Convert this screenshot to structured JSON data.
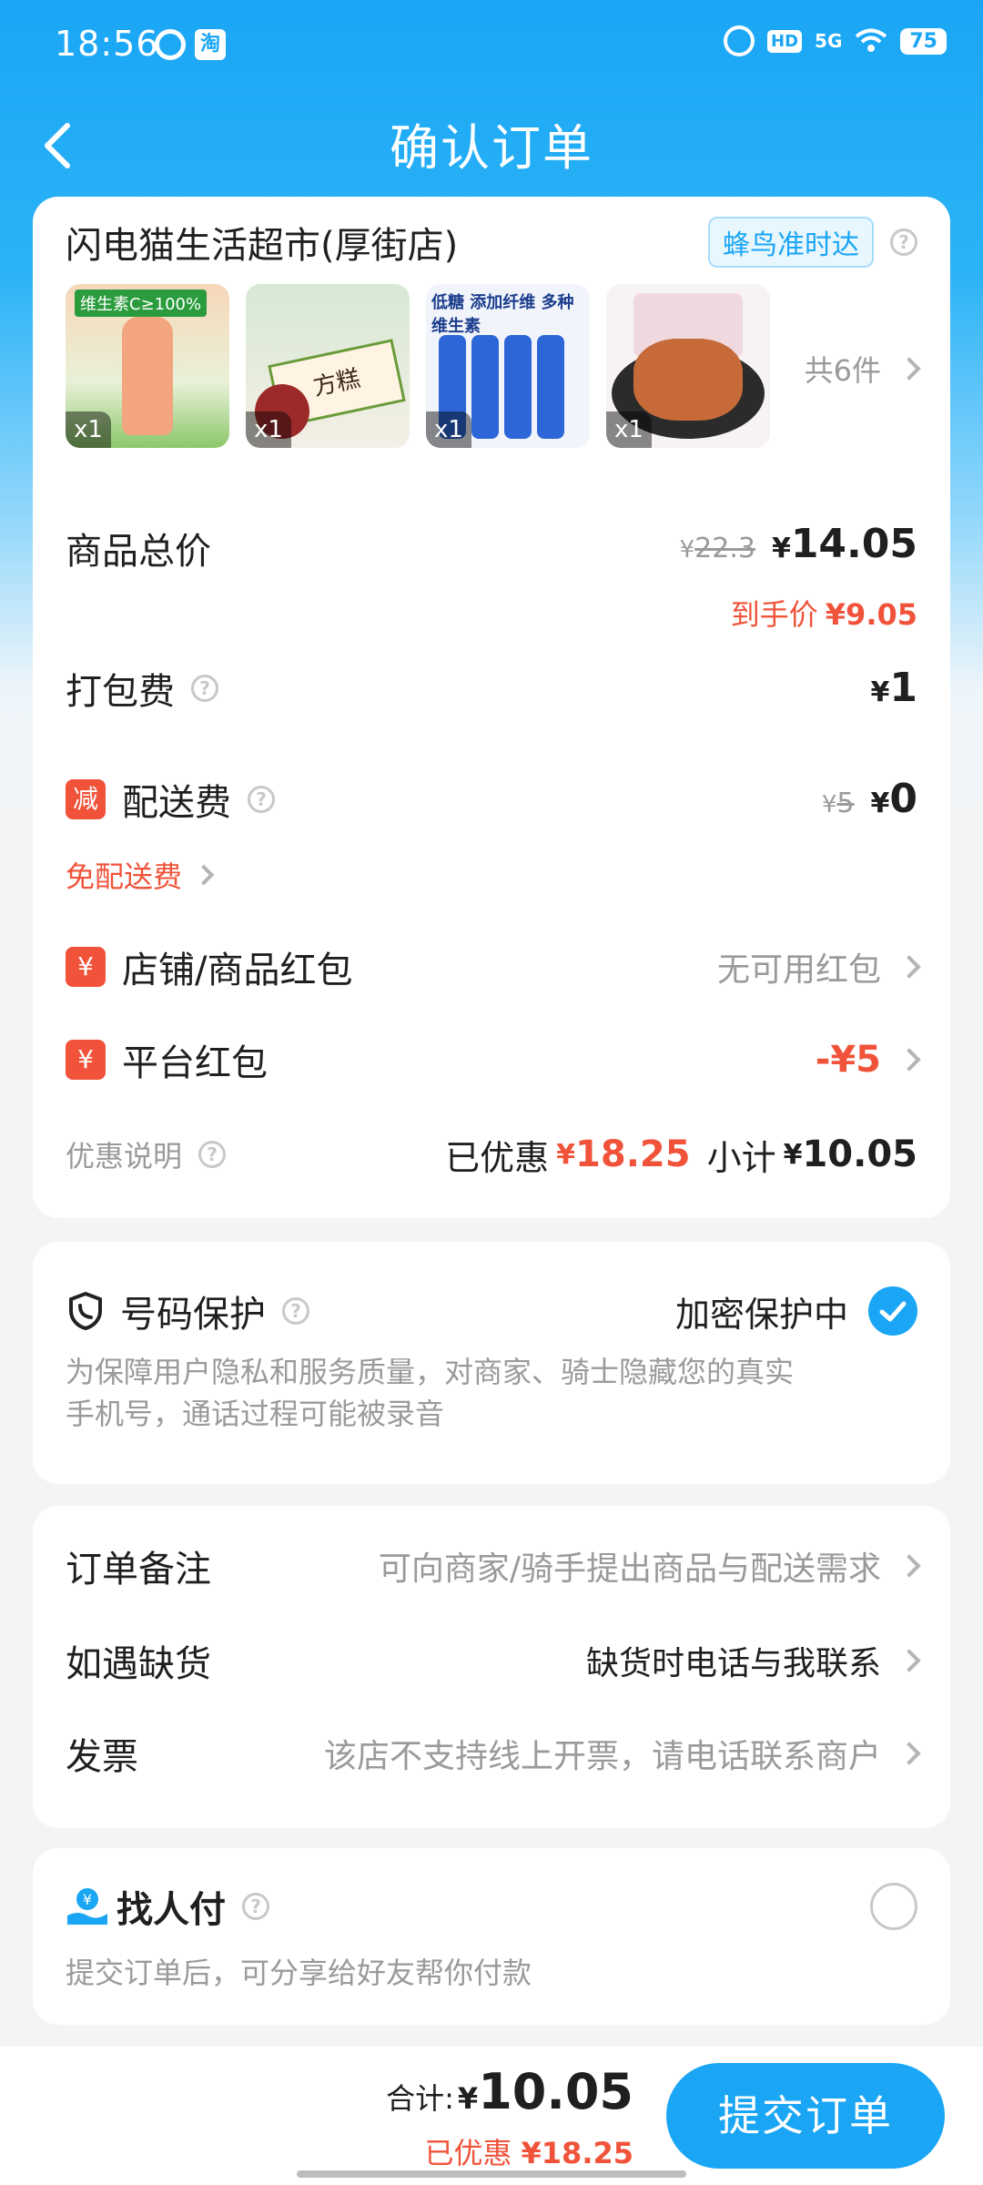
{
  "status_bar": {
    "time": "18:56",
    "battery": "75",
    "network": "5G"
  },
  "header": {
    "title": "确认订单"
  },
  "store": {
    "name": "闪电猫生活超市(厚街店)",
    "delivery_badge": "蜂鸟准时达",
    "items_count": "共6件",
    "items": [
      {
        "qty": "x1",
        "caption": "维生素C≥100%",
        "color": "#f3b58f"
      },
      {
        "qty": "x1",
        "caption": "方糕",
        "color": "#e8d2c0"
      },
      {
        "qty": "x1",
        "caption": "低糖 添加纤维 多种维生素",
        "color": "#2d66d6"
      },
      {
        "qty": "x1",
        "caption": "",
        "color": "#c66a3a"
      }
    ]
  },
  "summary": {
    "goods_total_label": "商品总价",
    "goods_original": "22.3",
    "goods_total": "14.05",
    "final_price_label": "到手价",
    "final_price": "¥9.05",
    "packing_fee_label": "打包费",
    "packing_fee": "1",
    "delivery_tag": "减",
    "delivery_fee_label": "配送费",
    "delivery_original": "5",
    "delivery_fee": "0",
    "free_delivery": "免配送费",
    "store_coupon_tag": "¥",
    "store_coupon_label": "店铺/商品红包",
    "store_coupon_value": "无可用红包",
    "platform_coupon_tag": "¥",
    "platform_coupon_label": "平台红包",
    "platform_coupon_value": "-¥5",
    "discount_desc_label": "优惠说明",
    "saved_label": "已优惠",
    "saved_value": "18.25",
    "subtotal_label": "小计",
    "subtotal_value": "10.05",
    "currency": "¥"
  },
  "privacy": {
    "title": "号码保护",
    "status": "加密保护中",
    "desc_line1": "为保障用户隐私和服务质量，对商家、骑士隐藏您的真实",
    "desc_line2": "手机号，通话过程可能被录音"
  },
  "options": {
    "note_label": "订单备注",
    "note_placeholder": "可向商家/骑手提出商品与配送需求",
    "stockout_label": "如遇缺货",
    "stockout_value": "缺货时电话与我联系",
    "invoice_label": "发票",
    "invoice_value": "该店不支持线上开票，请电话联系商户"
  },
  "pay_for_me": {
    "title": "找人付",
    "desc": "提交订单后，可分享给好友帮你付款"
  },
  "footer": {
    "total_label": "合计:",
    "currency": "¥",
    "total_value": "10.05",
    "saved_label": "已优惠",
    "saved_value": "¥18.25",
    "submit_label": "提交订单"
  },
  "colors": {
    "accent": "#1aa6f5",
    "red": "#f0533a"
  }
}
